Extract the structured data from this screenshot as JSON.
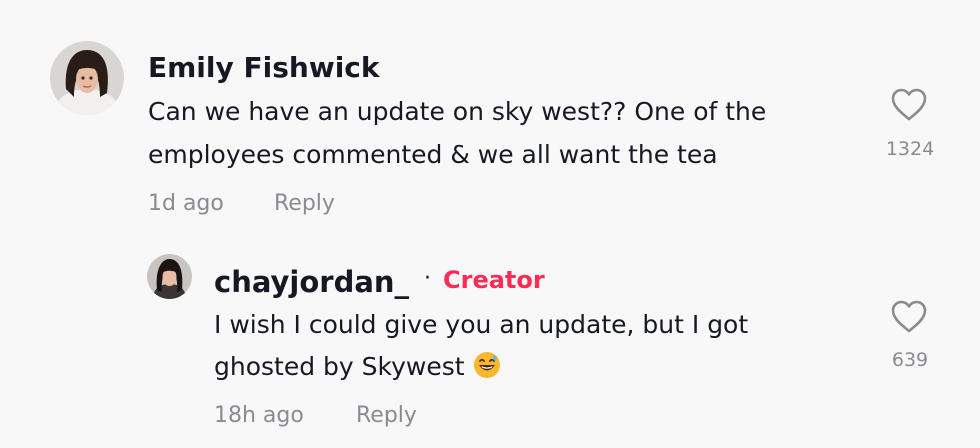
{
  "comments": [
    {
      "username": "Emily Fishwick",
      "lines": [
        "Can we have an update on sky west?? One of the",
        "employees commented & we all want the tea"
      ],
      "time": "1d ago",
      "reply_label": "Reply",
      "like_count": "1324"
    }
  ],
  "reply": {
    "username": "chayjordan_",
    "separator": "·",
    "creator_badge": "Creator",
    "lines": [
      "I wish I could give you an update, but I got",
      "ghosted by Skywest"
    ],
    "emoji": "grinning-sweat-emoji",
    "time": "18h ago",
    "reply_label": "Reply",
    "like_count": "639"
  },
  "colors": {
    "background": "#f8f8f8",
    "text": "#161823",
    "muted": "#8a8b91",
    "creator": "#fe2c55"
  },
  "icons": {
    "like": "heart-outline-icon",
    "emoji": "grinning-face-with-sweat-icon"
  }
}
